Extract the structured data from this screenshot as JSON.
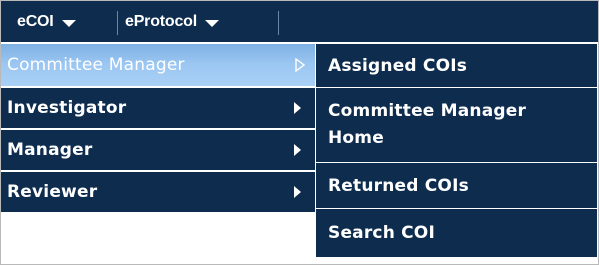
{
  "topbar": {
    "menus": [
      {
        "label": "eCOI",
        "icon": "caret-down-icon"
      },
      {
        "label": "eProtocol",
        "icon": "caret-down-icon"
      }
    ]
  },
  "ecoi_menu": {
    "items": [
      {
        "label": "Committee Manager",
        "active": true,
        "icon": "chevron-right-outline-icon"
      },
      {
        "label": "Investigator",
        "active": false,
        "icon": "chevron-right-icon"
      },
      {
        "label": "Manager",
        "active": false,
        "icon": "chevron-right-icon"
      },
      {
        "label": "Reviewer",
        "active": false,
        "icon": "chevron-right-icon"
      }
    ]
  },
  "committee_manager_submenu": {
    "items": [
      {
        "label": "Assigned COIs"
      },
      {
        "label": "Committee Manager Home"
      },
      {
        "label": "Returned COIs"
      },
      {
        "label": "Search COI"
      }
    ]
  },
  "colors": {
    "menu_bg": "#0e2c4e",
    "active_bg": "#9cc7f2",
    "text": "#ffffff"
  }
}
